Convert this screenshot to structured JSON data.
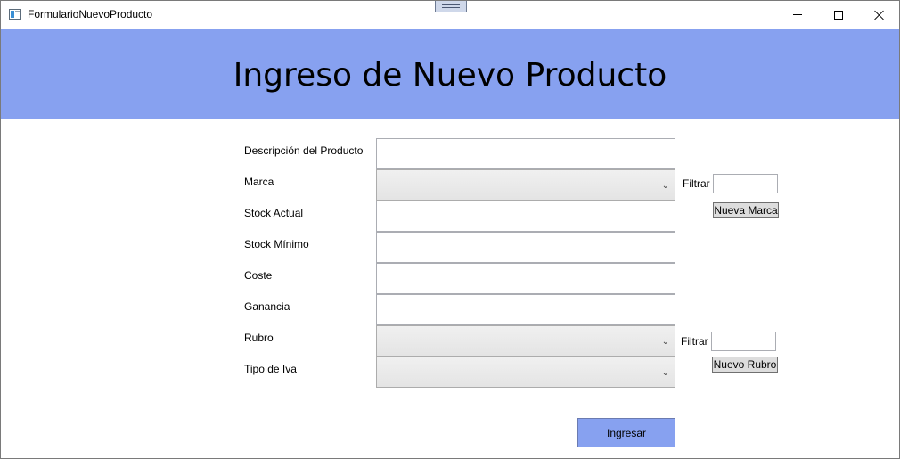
{
  "window": {
    "title": "FormularioNuevoProducto"
  },
  "header": {
    "title": "Ingreso de Nuevo Producto",
    "background_color": "#87a1f0"
  },
  "form": {
    "fields": {
      "descripcion": {
        "label": "Descripción del Producto",
        "value": ""
      },
      "marca": {
        "label": "Marca",
        "selected": ""
      },
      "stock_actual": {
        "label": "Stock Actual",
        "value": ""
      },
      "stock_minimo": {
        "label": "Stock Mínimo",
        "value": ""
      },
      "coste": {
        "label": "Coste",
        "value": ""
      },
      "ganancia": {
        "label": "Ganancia",
        "value": ""
      },
      "rubro": {
        "label": "Rubro",
        "selected": ""
      },
      "tipo_iva": {
        "label": "Tipo de Iva",
        "selected": ""
      }
    },
    "marca_filter": {
      "label": "Filtrar",
      "value": ""
    },
    "nueva_marca_label": "Nueva Marca",
    "rubro_filter": {
      "label": "Filtrar",
      "value": ""
    },
    "nuevo_rubro_label": "Nuevo Rubro",
    "submit_label": "Ingresar",
    "combo_arrow_glyph": "⌄"
  }
}
